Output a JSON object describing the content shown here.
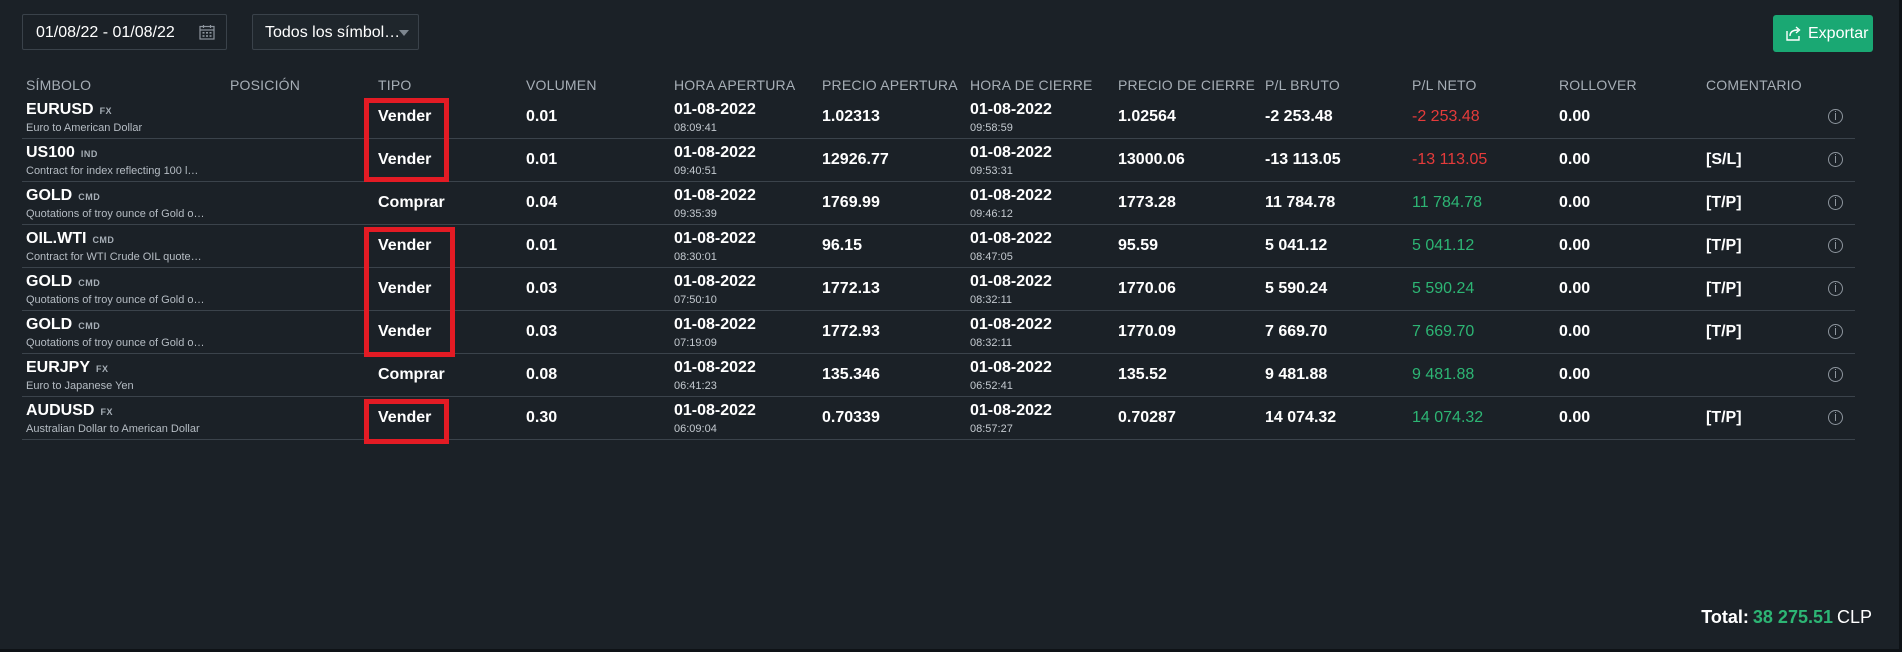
{
  "toolbar": {
    "date_range": "01/08/22 - 01/08/22",
    "symbol_filter": "Todos los símbol…",
    "export_label": "Exportar"
  },
  "columns": [
    "SÍMBOLO",
    "POSICIÓN",
    "TIPO",
    "VOLUMEN",
    "HORA APERTURA",
    "PRECIO APERTURA",
    "HORA DE CIERRE",
    "PRECIO DE CIERRE",
    "P/L BRUTO",
    "P/L NETO",
    "ROLLOVER",
    "COMENTARIO"
  ],
  "rows": [
    {
      "symbol": "EURUSD",
      "tag": "FX",
      "desc": "Euro to American Dollar",
      "type": "Vender",
      "volume": "0.01",
      "open_date": "01-08-2022",
      "open_time": "08:09:41",
      "open_price": "1.02313",
      "close_date": "01-08-2022",
      "close_time": "09:58:59",
      "close_price": "1.02564",
      "pl_gross": "-2 253.48",
      "pl_net": "-2 253.48",
      "pl_sign": "neg",
      "rollover": "0.00",
      "comment": ""
    },
    {
      "symbol": "US100",
      "tag": "IND",
      "desc": "Contract for index reflecting 100 l…",
      "type": "Vender",
      "volume": "0.01",
      "open_date": "01-08-2022",
      "open_time": "09:40:51",
      "open_price": "12926.77",
      "close_date": "01-08-2022",
      "close_time": "09:53:31",
      "close_price": "13000.06",
      "pl_gross": "-13 113.05",
      "pl_net": "-13 113.05",
      "pl_sign": "neg",
      "rollover": "0.00",
      "comment": "[S/L]"
    },
    {
      "symbol": "GOLD",
      "tag": "CMD",
      "desc": "Quotations of troy ounce of Gold o…",
      "type": "Comprar",
      "volume": "0.04",
      "open_date": "01-08-2022",
      "open_time": "09:35:39",
      "open_price": "1769.99",
      "close_date": "01-08-2022",
      "close_time": "09:46:12",
      "close_price": "1773.28",
      "pl_gross": "11 784.78",
      "pl_net": "11 784.78",
      "pl_sign": "pos",
      "rollover": "0.00",
      "comment": "[T/P]"
    },
    {
      "symbol": "OIL.WTI",
      "tag": "CMD",
      "desc": "Contract for WTI Crude OIL quote…",
      "type": "Vender",
      "volume": "0.01",
      "open_date": "01-08-2022",
      "open_time": "08:30:01",
      "open_price": "96.15",
      "close_date": "01-08-2022",
      "close_time": "08:47:05",
      "close_price": "95.59",
      "pl_gross": "5 041.12",
      "pl_net": "5 041.12",
      "pl_sign": "pos",
      "rollover": "0.00",
      "comment": "[T/P]"
    },
    {
      "symbol": "GOLD",
      "tag": "CMD",
      "desc": "Quotations of troy ounce of Gold o…",
      "type": "Vender",
      "volume": "0.03",
      "open_date": "01-08-2022",
      "open_time": "07:50:10",
      "open_price": "1772.13",
      "close_date": "01-08-2022",
      "close_time": "08:32:11",
      "close_price": "1770.06",
      "pl_gross": "5 590.24",
      "pl_net": "5 590.24",
      "pl_sign": "pos",
      "rollover": "0.00",
      "comment": "[T/P]"
    },
    {
      "symbol": "GOLD",
      "tag": "CMD",
      "desc": "Quotations of troy ounce of Gold o…",
      "type": "Vender",
      "volume": "0.03",
      "open_date": "01-08-2022",
      "open_time": "07:19:09",
      "open_price": "1772.93",
      "close_date": "01-08-2022",
      "close_time": "08:32:11",
      "close_price": "1770.09",
      "pl_gross": "7 669.70",
      "pl_net": "7 669.70",
      "pl_sign": "pos",
      "rollover": "0.00",
      "comment": "[T/P]"
    },
    {
      "symbol": "EURJPY",
      "tag": "FX",
      "desc": "Euro to Japanese Yen",
      "type": "Comprar",
      "volume": "0.08",
      "open_date": "01-08-2022",
      "open_time": "06:41:23",
      "open_price": "135.346",
      "close_date": "01-08-2022",
      "close_time": "06:52:41",
      "close_price": "135.52",
      "pl_gross": "9 481.88",
      "pl_net": "9 481.88",
      "pl_sign": "pos",
      "rollover": "0.00",
      "comment": ""
    },
    {
      "symbol": "AUDUSD",
      "tag": "FX",
      "desc": "Australian Dollar to American Dollar",
      "type": "Vender",
      "volume": "0.30",
      "open_date": "01-08-2022",
      "open_time": "06:09:04",
      "open_price": "0.70339",
      "close_date": "01-08-2022",
      "close_time": "08:57:27",
      "close_price": "0.70287",
      "pl_gross": "14 074.32",
      "pl_net": "14 074.32",
      "pl_sign": "pos",
      "rollover": "0.00",
      "comment": "[T/P]"
    }
  ],
  "total": {
    "label": "Total:",
    "amount": "38 275.51",
    "currency": "CLP"
  },
  "colors": {
    "negative": "#e53b3b",
    "positive": "#2db574",
    "accent": "#1aa873",
    "highlight": "#e31b24"
  }
}
